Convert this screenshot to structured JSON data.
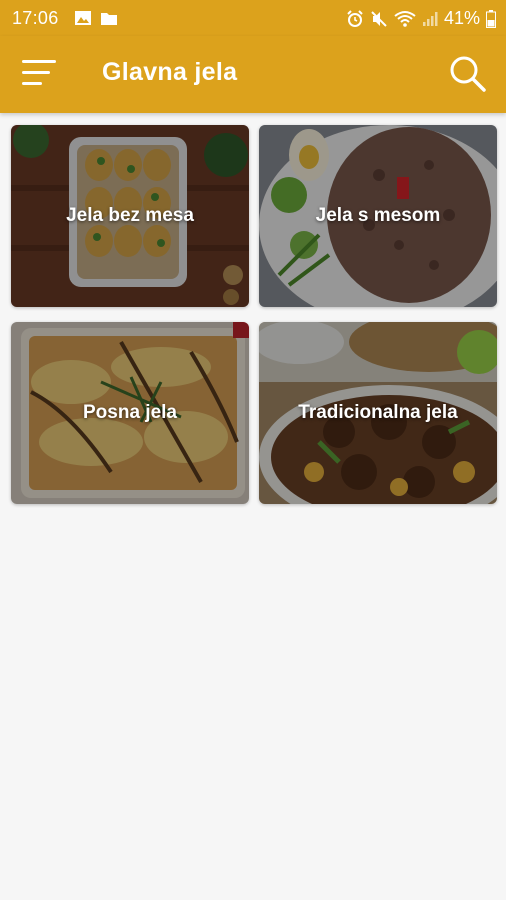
{
  "status_bar": {
    "time": "17:06",
    "battery": "41%",
    "left_icons": [
      "image-icon",
      "folder-icon"
    ],
    "right_icons": [
      "alarm-icon",
      "mute-icon",
      "wifi-icon",
      "signal-icon",
      "battery-icon"
    ]
  },
  "app_bar": {
    "title": "Glavna jela",
    "color": "#dca21c"
  },
  "categories": [
    {
      "label": "Jela bez mesa"
    },
    {
      "label": "Jela s mesom"
    },
    {
      "label": "Posna jela"
    },
    {
      "label": "Tradicionalna jela"
    }
  ]
}
